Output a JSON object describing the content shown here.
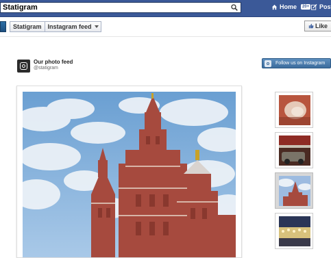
{
  "fb": {
    "search_value": "Statigram",
    "home_label": "Home",
    "home_badge": "20+",
    "post_label": "Post"
  },
  "app": {
    "tab_name": "Statigram",
    "tab_feed": "Instagram feed",
    "like_label": "Like"
  },
  "profile": {
    "title": "Our photo feed",
    "username": "@statigram",
    "follow_label": "Follow us on Instagram"
  },
  "colors": {
    "fb_blue": "#3b5998",
    "follow_blue": "#4a7aab"
  },
  "icons": [
    "search-icon",
    "home-icon",
    "post-icon",
    "thumbs-up-icon",
    "instagram-camera-icon"
  ]
}
